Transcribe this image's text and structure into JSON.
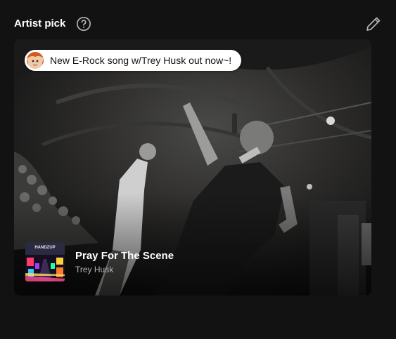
{
  "header": {
    "title": "Artist pick"
  },
  "card": {
    "bubble_text": "New E-Rock song w/Trey Husk out now~!",
    "track_title": "Pray For The Scene",
    "track_artist": "Trey Husk",
    "cover_text": "HANDZUP"
  },
  "icons": {
    "help": "help-circle-icon",
    "edit": "pencil-icon"
  },
  "colors": {
    "background": "#121212",
    "title": "#ffffff",
    "icon": "#b3b3b3",
    "artist_text": "#b3b3b3"
  }
}
